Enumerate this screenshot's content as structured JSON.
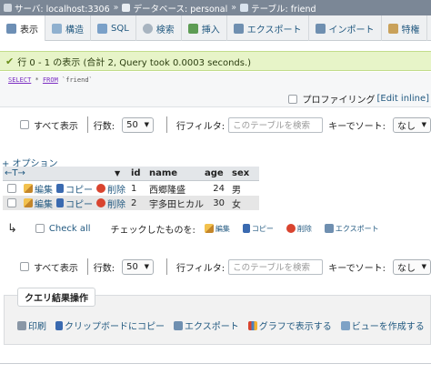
{
  "breadcrumb": {
    "items": [
      "サーバ: localhost:3306",
      "データベース: personal",
      "テーブル: friend"
    ]
  },
  "tabs": [
    {
      "label": "表示",
      "icon": "browse-icon",
      "active": true
    },
    {
      "label": "構造",
      "icon": "structure-icon"
    },
    {
      "label": "SQL",
      "icon": "sql-icon"
    },
    {
      "label": "検索",
      "icon": "search-icon"
    },
    {
      "label": "挿入",
      "icon": "insert-icon"
    },
    {
      "label": "エクスポート",
      "icon": "export-icon"
    },
    {
      "label": "インポート",
      "icon": "import-icon"
    },
    {
      "label": "特権",
      "icon": "privileges-icon"
    }
  ],
  "message": {
    "text": "行 0 - 1 の表示 (合計 2, Query took 0.0003 seconds.)"
  },
  "sql": {
    "select": "SELECT",
    "star": " * ",
    "from": "FROM",
    "table": " `friend`"
  },
  "profiling": {
    "label": "プロファイリング",
    "edit_inline": "[Edit inline]"
  },
  "nav_top": {
    "show_all": "すべて表示",
    "rows_label": "行数:",
    "rows_value": "50",
    "row_filter_label": "行フィルタ:",
    "filter_placeholder": "このテーブルを検索",
    "sort_label": "キーでソート:",
    "sort_value": "なし"
  },
  "options_link": "+ オプション",
  "table": {
    "arrows": "←T→",
    "headers": [
      "id",
      "name",
      "age",
      "sex"
    ],
    "action_labels": {
      "edit": "編集",
      "copy": "コピー",
      "delete": "削除"
    },
    "rows": [
      {
        "id": "1",
        "name": "西郷隆盛",
        "age": "24",
        "sex": "男"
      },
      {
        "id": "2",
        "name": "宇多田ヒカル",
        "age": "30",
        "sex": "女"
      }
    ]
  },
  "bulk": {
    "check_all": "Check all",
    "with_selected": "チェックしたものを:",
    "edit": "編集",
    "copy": "コピー",
    "delete": "削除",
    "export": "エクスポート"
  },
  "nav_bottom": {
    "show_all": "すべて表示",
    "rows_label": "行数:",
    "rows_value": "50",
    "row_filter_label": "行フィルタ:",
    "filter_placeholder": "このテーブルを検索",
    "sort_label": "キーでソート:",
    "sort_value": "なし"
  },
  "query_ops": {
    "title": "クエリ結果操作",
    "print": "印刷",
    "clipboard": "クリップボードにコピー",
    "export": "エクスポート",
    "chart": "グラフで表示する",
    "view": "ビューを作成する"
  },
  "colors": {
    "link": "#235a81",
    "success_bg": "#e7f4c8",
    "breadcrumb_bg": "#7b8796"
  }
}
